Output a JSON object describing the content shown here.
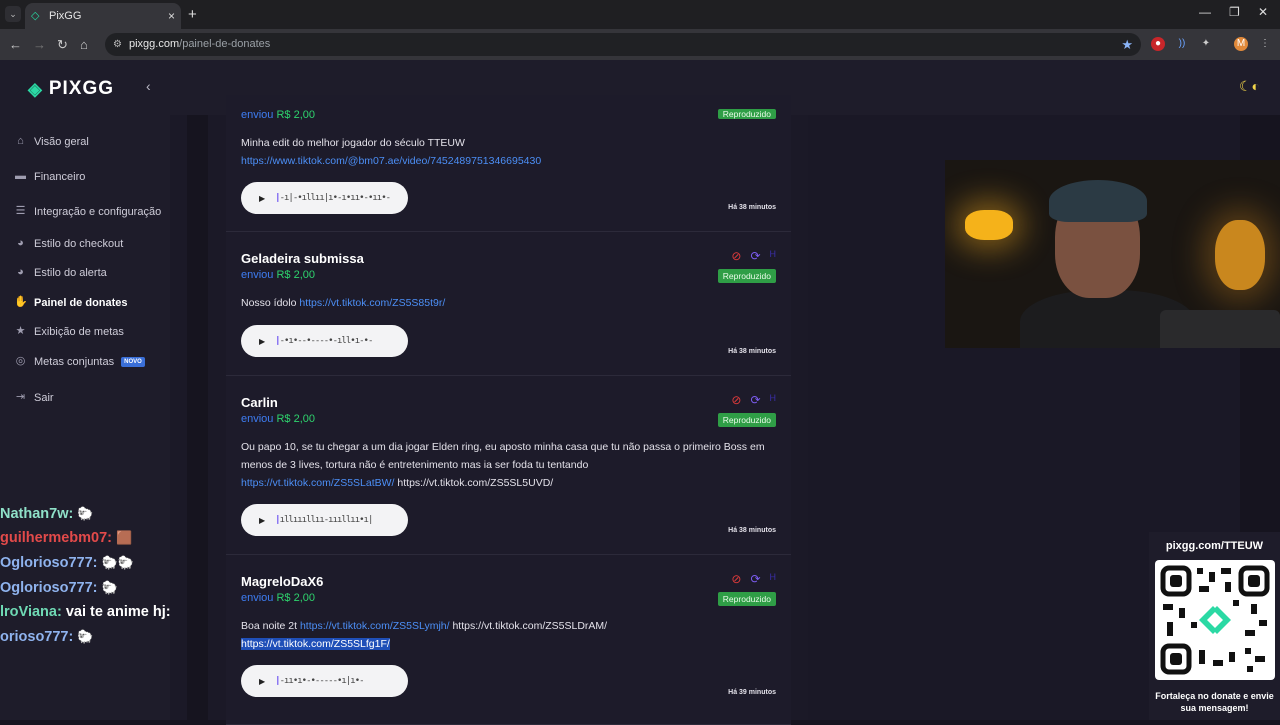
{
  "browser": {
    "tab_title": "PixGG",
    "url_host": "pixgg.com",
    "url_path": "/painel-de-donates",
    "profile_initial": "M"
  },
  "sidebar": {
    "logo": "PIXGG",
    "items": [
      {
        "label": "Visão geral",
        "icon": "home-icon"
      },
      {
        "label": "Financeiro",
        "icon": "wallet-icon"
      },
      {
        "label": "Integração e configuração",
        "icon": "settings-icon"
      },
      {
        "label": "Estilo do checkout",
        "icon": "palette-icon"
      },
      {
        "label": "Estilo do alerta",
        "icon": "palette-icon"
      },
      {
        "label": "Painel de donates",
        "icon": "donate-icon",
        "active": true
      },
      {
        "label": "Exibição de metas",
        "icon": "star-icon"
      },
      {
        "label": "Metas conjuntas",
        "icon": "target-icon",
        "badge": "NOVO"
      },
      {
        "label": "Sair",
        "icon": "logout-icon"
      }
    ]
  },
  "donations": [
    {
      "name": "",
      "sent_label": "enviou",
      "amount": "R$ 2,00",
      "message": "Minha edit do melhor jogador do século TTEUW",
      "links": [
        "https://www.tiktok.com/@bm07.ae/video/7452489751346695430"
      ],
      "time": "Há 38 minutos",
      "status": "Reproduzido"
    },
    {
      "name": "Geladeira submissa",
      "sent_label": "enviou",
      "amount": "R$ 2,00",
      "message": "Nosso ídolo",
      "links": [
        "https://vt.tiktok.com/ZS5S85t9r/"
      ],
      "time": "Há 38 minutos",
      "status": "Reproduzido"
    },
    {
      "name": "Carlin",
      "sent_label": "enviou",
      "amount": "R$ 2,00",
      "message": "Ou papo 10, se tu chegar a um dia jogar Elden ring, eu aposto minha casa que tu não passa o primeiro Boss em menos de 3 lives, tortura não é entretenimento mas ia ser foda tu tentando",
      "links": [
        "https://vt.tiktok.com/ZS5SLatBW/",
        "https://vt.tiktok.com/ZS5SL5UVD/"
      ],
      "time": "Há 38 minutos",
      "status": "Reproduzido"
    },
    {
      "name": "MagreloDaX6",
      "sent_label": "enviou",
      "amount": "R$ 2,00",
      "message": "Boa noite 2t",
      "links": [
        "https://vt.tiktok.com/ZS5SLymjh/",
        "https://vt.tiktok.com/ZS5SLDrAM/",
        "https://vt.tiktok.com/ZS5SLfg1F/"
      ],
      "time": "Há 39 minutos",
      "status": "Reproduzido"
    }
  ],
  "chat": [
    {
      "user": "Nathan7w:",
      "text": "",
      "color": "#8fe0c8"
    },
    {
      "user": "guilhermebm07:",
      "text": "",
      "color": "#e24a4a"
    },
    {
      "user": "Oglorioso777:",
      "text": "",
      "color": "#8fb3ee"
    },
    {
      "user": "Oglorioso777:",
      "text": "",
      "color": "#8fb3ee"
    },
    {
      "user": "lroViana:",
      "text": "vai te anime hj:",
      "color": "#6fd9b4"
    },
    {
      "user": "orioso777:",
      "text": "",
      "color": "#8fb3ee"
    }
  ],
  "qr": {
    "title": "pixgg.com/TTEUW",
    "caption": "Fortaleça no donate e envie sua mensagem!"
  }
}
